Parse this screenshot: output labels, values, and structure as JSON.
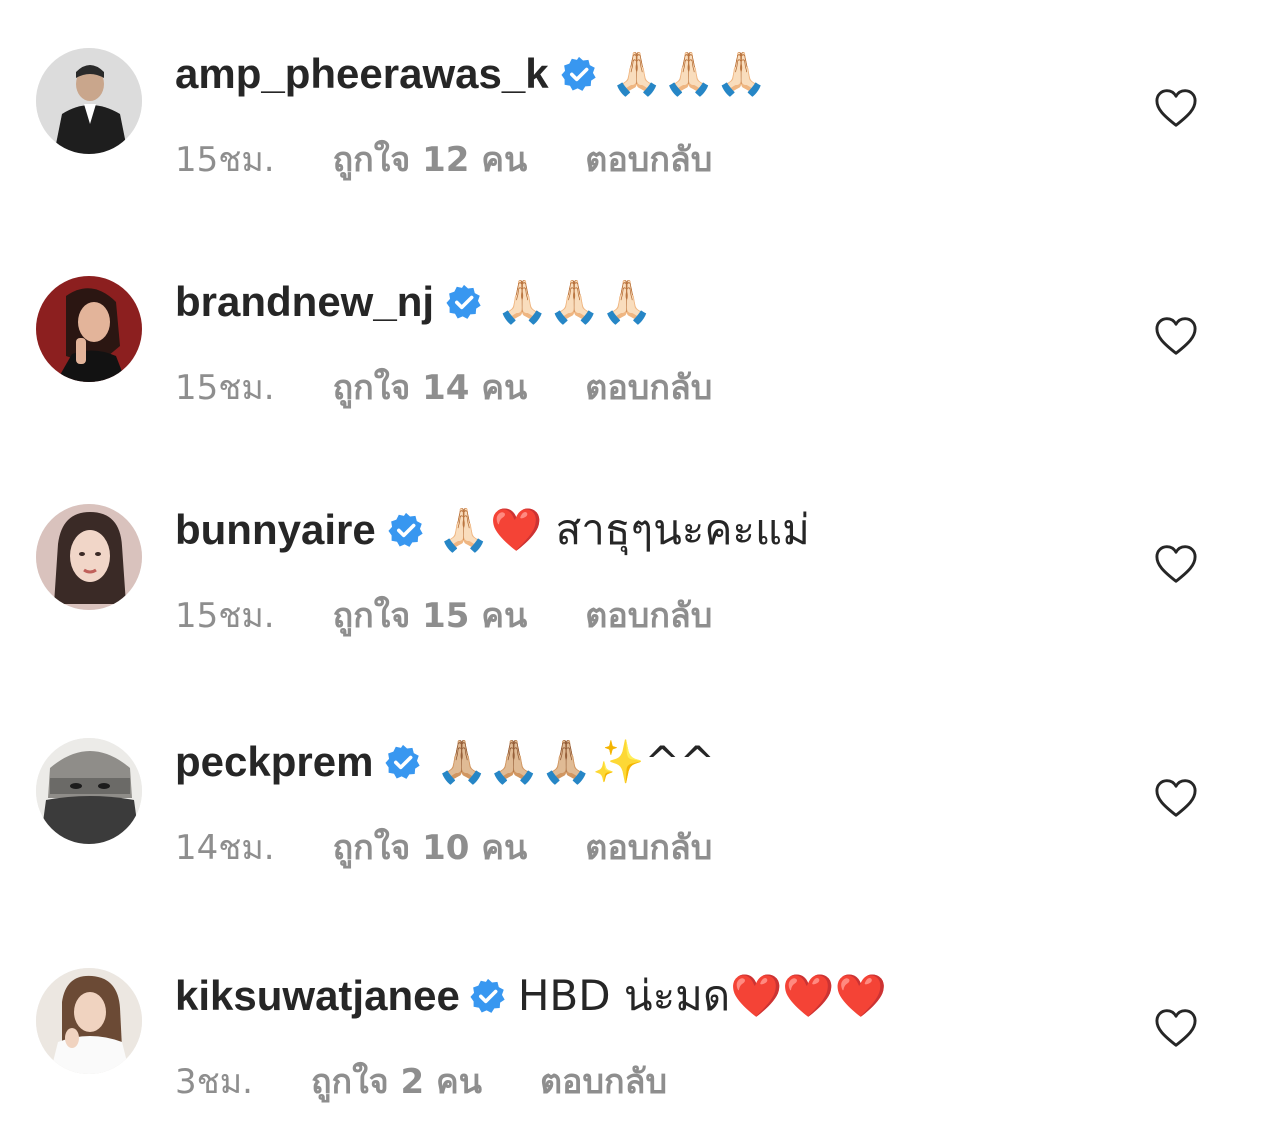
{
  "comments": [
    {
      "username": "amp_pheerawas_k",
      "text": "🙏🏻🙏🏻🙏🏻",
      "time": "15ชม.",
      "likes": "ถูกใจ 12 คน",
      "reply": "ตอบกลับ",
      "avatar_colors": [
        "#dcdcdc",
        "#1e1e1e"
      ]
    },
    {
      "username": "brandnew_nj",
      "text": "🙏🏻🙏🏻🙏🏻",
      "time": "15ชม.",
      "likes": "ถูกใจ 14 คน",
      "reply": "ตอบกลับ",
      "avatar_colors": [
        "#8c1f1f",
        "#e3b49a"
      ]
    },
    {
      "username": "bunnyaire",
      "text": "🙏🏻❤️ สาธุๆนะคะแม่",
      "time": "15ชม.",
      "likes": "ถูกใจ 15 คน",
      "reply": "ตอบกลับ",
      "avatar_colors": [
        "#d9c2bd",
        "#3a2a26"
      ]
    },
    {
      "username": "peckprem",
      "text": "🙏🏼🙏🏼🙏🏼✨^^",
      "time": "14ชม.",
      "likes": "ถูกใจ 10 คน",
      "reply": "ตอบกลับ",
      "avatar_colors": [
        "#b9b7b3",
        "#3b3b3b"
      ]
    },
    {
      "username": "kiksuwatjanee",
      "text": "HBD น่ะมด❤️❤️❤️",
      "time": "3ชม.",
      "likes": "ถูกใจ 2 คน",
      "reply": "ตอบกลับ",
      "avatar_colors": [
        "#ece7e1",
        "#6b4a35"
      ]
    }
  ],
  "icons": {
    "verified": "verified-badge-icon",
    "like": "heart-outline-icon"
  },
  "colors": {
    "text_primary": "#262626",
    "text_secondary": "#8e8e8e",
    "verified_blue": "#3897f0"
  }
}
